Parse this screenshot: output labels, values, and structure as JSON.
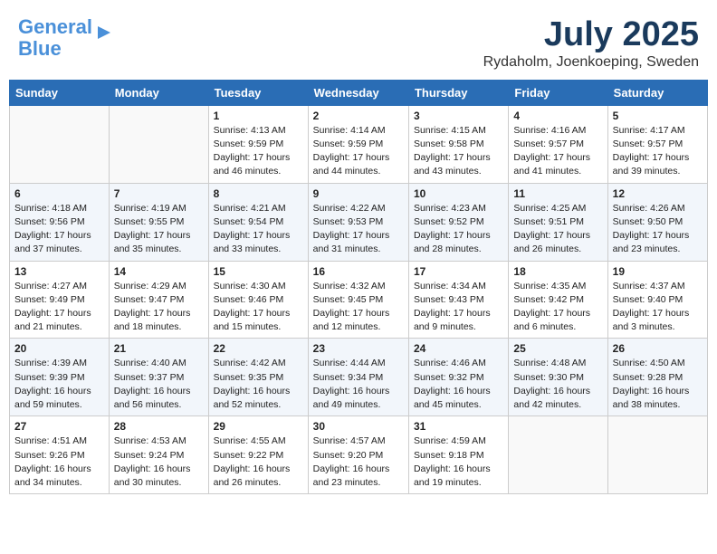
{
  "logo": {
    "line1": "General",
    "line2": "Blue"
  },
  "title": "July 2025",
  "location": "Rydaholm, Joenkoeping, Sweden",
  "weekdays": [
    "Sunday",
    "Monday",
    "Tuesday",
    "Wednesday",
    "Thursday",
    "Friday",
    "Saturday"
  ],
  "weeks": [
    [
      {
        "day": "",
        "info": ""
      },
      {
        "day": "",
        "info": ""
      },
      {
        "day": "1",
        "info": "Sunrise: 4:13 AM\nSunset: 9:59 PM\nDaylight: 17 hours\nand 46 minutes."
      },
      {
        "day": "2",
        "info": "Sunrise: 4:14 AM\nSunset: 9:59 PM\nDaylight: 17 hours\nand 44 minutes."
      },
      {
        "day": "3",
        "info": "Sunrise: 4:15 AM\nSunset: 9:58 PM\nDaylight: 17 hours\nand 43 minutes."
      },
      {
        "day": "4",
        "info": "Sunrise: 4:16 AM\nSunset: 9:57 PM\nDaylight: 17 hours\nand 41 minutes."
      },
      {
        "day": "5",
        "info": "Sunrise: 4:17 AM\nSunset: 9:57 PM\nDaylight: 17 hours\nand 39 minutes."
      }
    ],
    [
      {
        "day": "6",
        "info": "Sunrise: 4:18 AM\nSunset: 9:56 PM\nDaylight: 17 hours\nand 37 minutes."
      },
      {
        "day": "7",
        "info": "Sunrise: 4:19 AM\nSunset: 9:55 PM\nDaylight: 17 hours\nand 35 minutes."
      },
      {
        "day": "8",
        "info": "Sunrise: 4:21 AM\nSunset: 9:54 PM\nDaylight: 17 hours\nand 33 minutes."
      },
      {
        "day": "9",
        "info": "Sunrise: 4:22 AM\nSunset: 9:53 PM\nDaylight: 17 hours\nand 31 minutes."
      },
      {
        "day": "10",
        "info": "Sunrise: 4:23 AM\nSunset: 9:52 PM\nDaylight: 17 hours\nand 28 minutes."
      },
      {
        "day": "11",
        "info": "Sunrise: 4:25 AM\nSunset: 9:51 PM\nDaylight: 17 hours\nand 26 minutes."
      },
      {
        "day": "12",
        "info": "Sunrise: 4:26 AM\nSunset: 9:50 PM\nDaylight: 17 hours\nand 23 minutes."
      }
    ],
    [
      {
        "day": "13",
        "info": "Sunrise: 4:27 AM\nSunset: 9:49 PM\nDaylight: 17 hours\nand 21 minutes."
      },
      {
        "day": "14",
        "info": "Sunrise: 4:29 AM\nSunset: 9:47 PM\nDaylight: 17 hours\nand 18 minutes."
      },
      {
        "day": "15",
        "info": "Sunrise: 4:30 AM\nSunset: 9:46 PM\nDaylight: 17 hours\nand 15 minutes."
      },
      {
        "day": "16",
        "info": "Sunrise: 4:32 AM\nSunset: 9:45 PM\nDaylight: 17 hours\nand 12 minutes."
      },
      {
        "day": "17",
        "info": "Sunrise: 4:34 AM\nSunset: 9:43 PM\nDaylight: 17 hours\nand 9 minutes."
      },
      {
        "day": "18",
        "info": "Sunrise: 4:35 AM\nSunset: 9:42 PM\nDaylight: 17 hours\nand 6 minutes."
      },
      {
        "day": "19",
        "info": "Sunrise: 4:37 AM\nSunset: 9:40 PM\nDaylight: 17 hours\nand 3 minutes."
      }
    ],
    [
      {
        "day": "20",
        "info": "Sunrise: 4:39 AM\nSunset: 9:39 PM\nDaylight: 16 hours\nand 59 minutes."
      },
      {
        "day": "21",
        "info": "Sunrise: 4:40 AM\nSunset: 9:37 PM\nDaylight: 16 hours\nand 56 minutes."
      },
      {
        "day": "22",
        "info": "Sunrise: 4:42 AM\nSunset: 9:35 PM\nDaylight: 16 hours\nand 52 minutes."
      },
      {
        "day": "23",
        "info": "Sunrise: 4:44 AM\nSunset: 9:34 PM\nDaylight: 16 hours\nand 49 minutes."
      },
      {
        "day": "24",
        "info": "Sunrise: 4:46 AM\nSunset: 9:32 PM\nDaylight: 16 hours\nand 45 minutes."
      },
      {
        "day": "25",
        "info": "Sunrise: 4:48 AM\nSunset: 9:30 PM\nDaylight: 16 hours\nand 42 minutes."
      },
      {
        "day": "26",
        "info": "Sunrise: 4:50 AM\nSunset: 9:28 PM\nDaylight: 16 hours\nand 38 minutes."
      }
    ],
    [
      {
        "day": "27",
        "info": "Sunrise: 4:51 AM\nSunset: 9:26 PM\nDaylight: 16 hours\nand 34 minutes."
      },
      {
        "day": "28",
        "info": "Sunrise: 4:53 AM\nSunset: 9:24 PM\nDaylight: 16 hours\nand 30 minutes."
      },
      {
        "day": "29",
        "info": "Sunrise: 4:55 AM\nSunset: 9:22 PM\nDaylight: 16 hours\nand 26 minutes."
      },
      {
        "day": "30",
        "info": "Sunrise: 4:57 AM\nSunset: 9:20 PM\nDaylight: 16 hours\nand 23 minutes."
      },
      {
        "day": "31",
        "info": "Sunrise: 4:59 AM\nSunset: 9:18 PM\nDaylight: 16 hours\nand 19 minutes."
      },
      {
        "day": "",
        "info": ""
      },
      {
        "day": "",
        "info": ""
      }
    ]
  ]
}
